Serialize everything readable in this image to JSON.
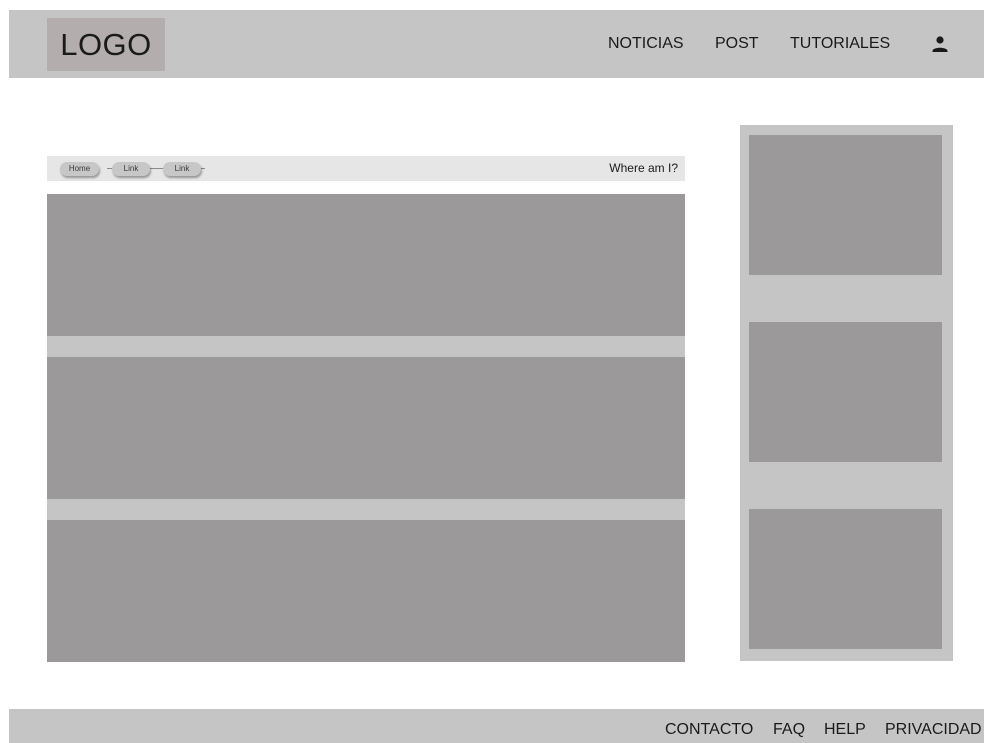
{
  "header": {
    "logo": "LOGO",
    "nav": [
      "NOTICIAS",
      "POST",
      "TUTORIALES"
    ],
    "user_icon": "user-icon"
  },
  "breadcrumb": {
    "items": [
      "Home",
      "Link",
      "Link"
    ],
    "where": "Where am I?"
  },
  "main": {
    "blocks": 3
  },
  "sidebar": {
    "blocks": 3
  },
  "footer": {
    "links": [
      "CONTACTO",
      "FAQ",
      "HELP",
      "PRIVACIDAD"
    ]
  },
  "colors": {
    "bar": "#c5c5c5",
    "placeholder": "#9b9999",
    "logo_bg": "#b3adad",
    "breadcrumb_bg": "#e6e6e6"
  }
}
